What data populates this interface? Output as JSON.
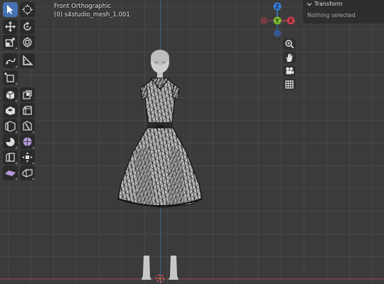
{
  "viewport": {
    "view_name": "Front Orthographic",
    "object_label": "(0) s4studio_mesh_1.001"
  },
  "gizmo": {
    "axes": [
      "Z",
      "Y",
      "X"
    ],
    "colors": {
      "x": "#c9404f",
      "y": "#78b72d",
      "z": "#3b7dd8",
      "neg_x": "#7a3a44",
      "neg_z": "#35598f"
    }
  },
  "sidebar": {
    "panel_title": "Transform",
    "empty_message": "Nothing selected"
  },
  "toolbar": {
    "tools": [
      "select-box",
      "cursor",
      "move",
      "rotate",
      "scale",
      "transform",
      "annotate",
      "measure",
      "add-cube",
      "extrude",
      "extrude-individual",
      "inset",
      "bevel",
      "loop-cut",
      "knife",
      "poly-build",
      "spin",
      "smooth",
      "edge-slide",
      "shrink-fatten",
      "shear",
      "rip"
    ],
    "active_tool": "select-box"
  },
  "nav_buttons": [
    "zoom",
    "pan",
    "camera",
    "perspective-toggle"
  ]
}
